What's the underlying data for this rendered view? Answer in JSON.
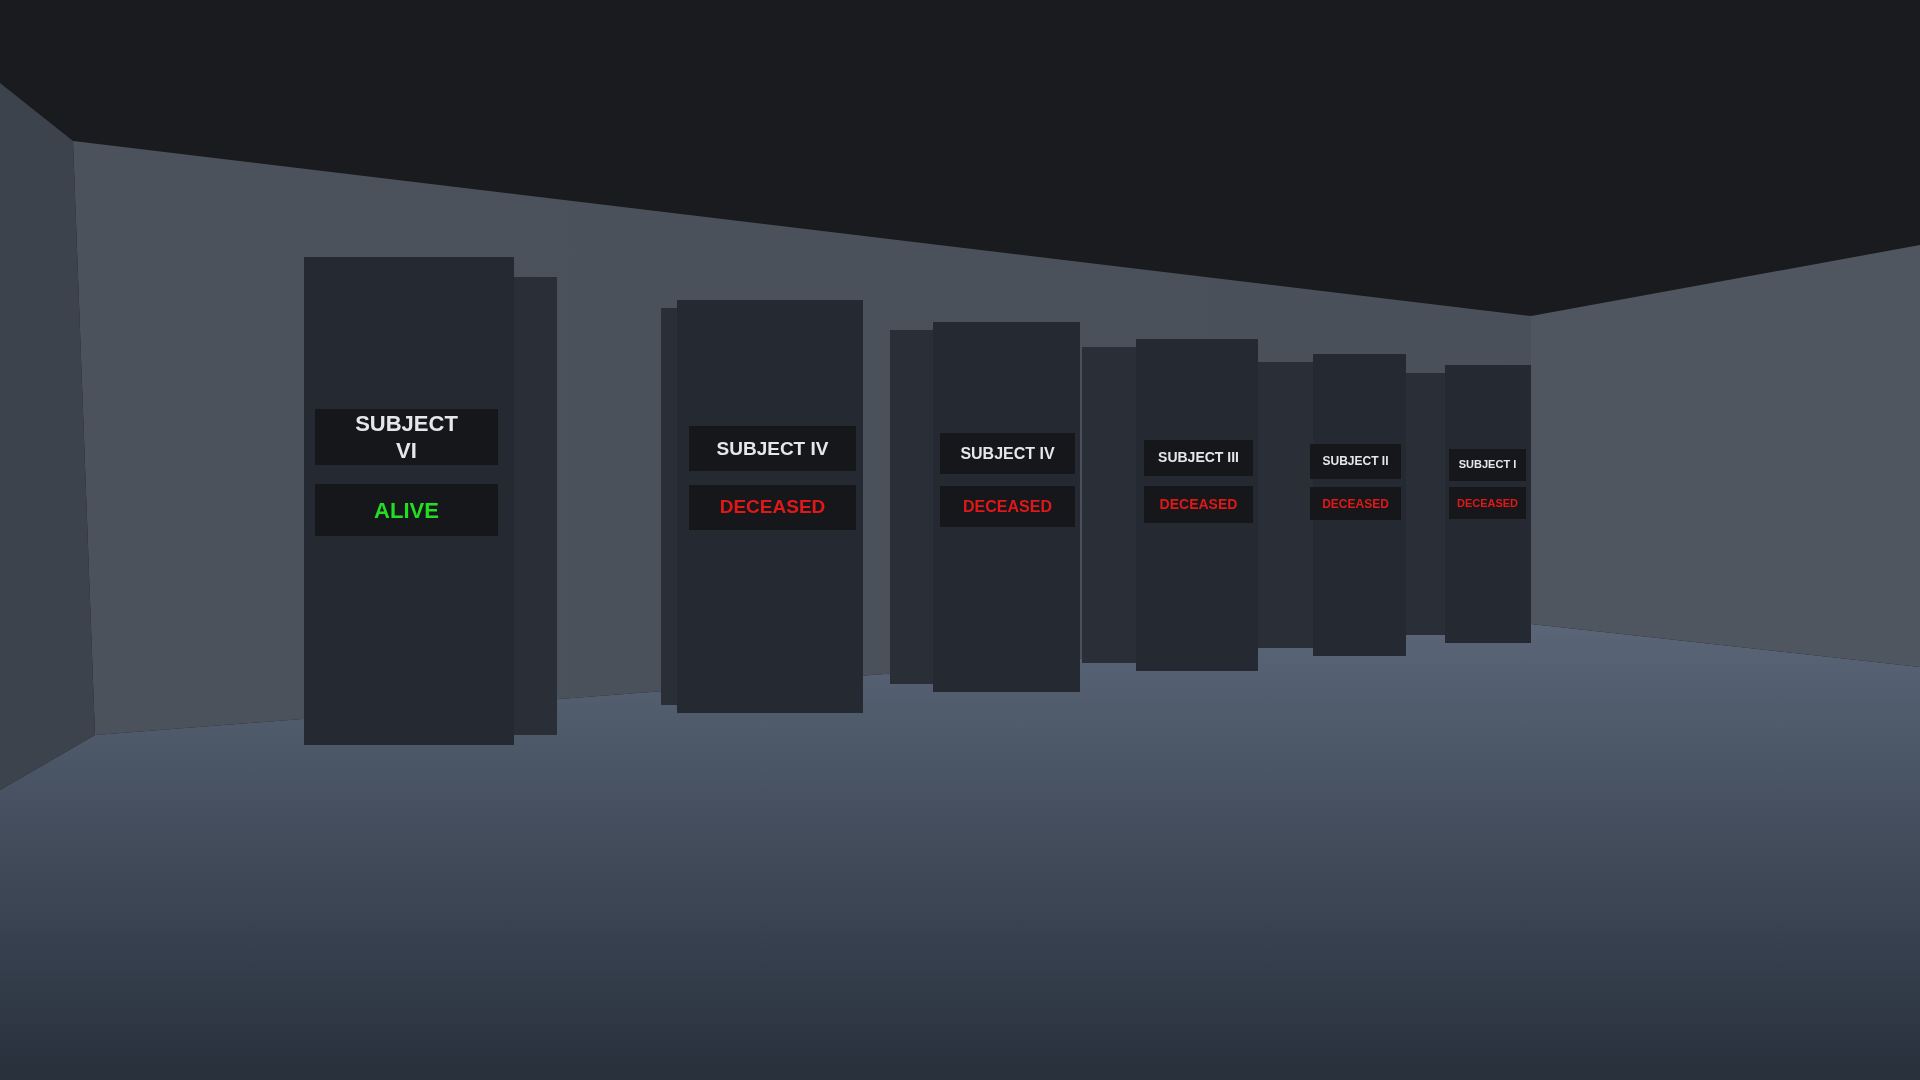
{
  "cabinets": [
    {
      "name": "SUBJECT VI",
      "status": "ALIVE",
      "color": "#22dd22"
    },
    {
      "name": "SUBJECT IV",
      "status": "DECEASED",
      "color": "#e01818"
    },
    {
      "name": "SUBJECT IV",
      "status": "DECEASED",
      "color": "#e01818"
    },
    {
      "name": "SUBJECT III",
      "status": "DECEASED",
      "color": "#e01818"
    },
    {
      "name": "SUBJECT II",
      "status": "DECEASED",
      "color": "#e01818"
    },
    {
      "name": "SUBJECT I",
      "status": "DECEASED",
      "color": "#e01818"
    }
  ]
}
